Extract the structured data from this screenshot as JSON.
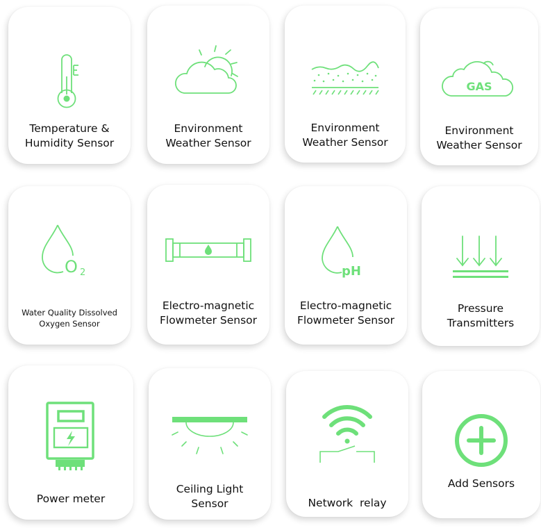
{
  "accent_color": "#6EE07A",
  "cards": [
    {
      "icon": "thermometer-icon",
      "label_lines": [
        "Temperature &",
        "Humidity Sensor"
      ]
    },
    {
      "icon": "cloud-sun-icon",
      "label_lines": [
        "Environment",
        "Weather Sensor"
      ]
    },
    {
      "icon": "soil-layers-icon",
      "label_lines": [
        "Environment",
        "Weather Sensor"
      ]
    },
    {
      "icon": "gas-cloud-icon",
      "icon_text": "GAS",
      "label_lines": [
        "Environment",
        "Weather Sensor"
      ]
    },
    {
      "icon": "water-drop-oxygen-icon",
      "icon_text": "O",
      "icon_subscript": "2",
      "label_lines": [
        "Water Quality Dissolved",
        "Oxygen Sensor"
      ]
    },
    {
      "icon": "flow-pipe-icon",
      "label_lines": [
        "Electro-magnetic",
        "Flowmeter Sensor"
      ]
    },
    {
      "icon": "water-drop-ph-icon",
      "icon_text": "pH",
      "label_lines": [
        "Electro-magnetic",
        "Flowmeter Sensor"
      ]
    },
    {
      "icon": "pressure-arrows-icon",
      "label_lines": [
        "Pressure",
        "Transmitters"
      ]
    },
    {
      "icon": "power-meter-icon",
      "label_lines": [
        "Power meter"
      ]
    },
    {
      "icon": "ceiling-light-icon",
      "label_lines": [
        "Ceiling Light",
        "Sensor"
      ]
    },
    {
      "icon": "wifi-relay-icon",
      "label_lines": [
        "Network  relay"
      ]
    },
    {
      "icon": "add-circle-icon",
      "label_lines": [
        "Add Sensors"
      ]
    }
  ]
}
